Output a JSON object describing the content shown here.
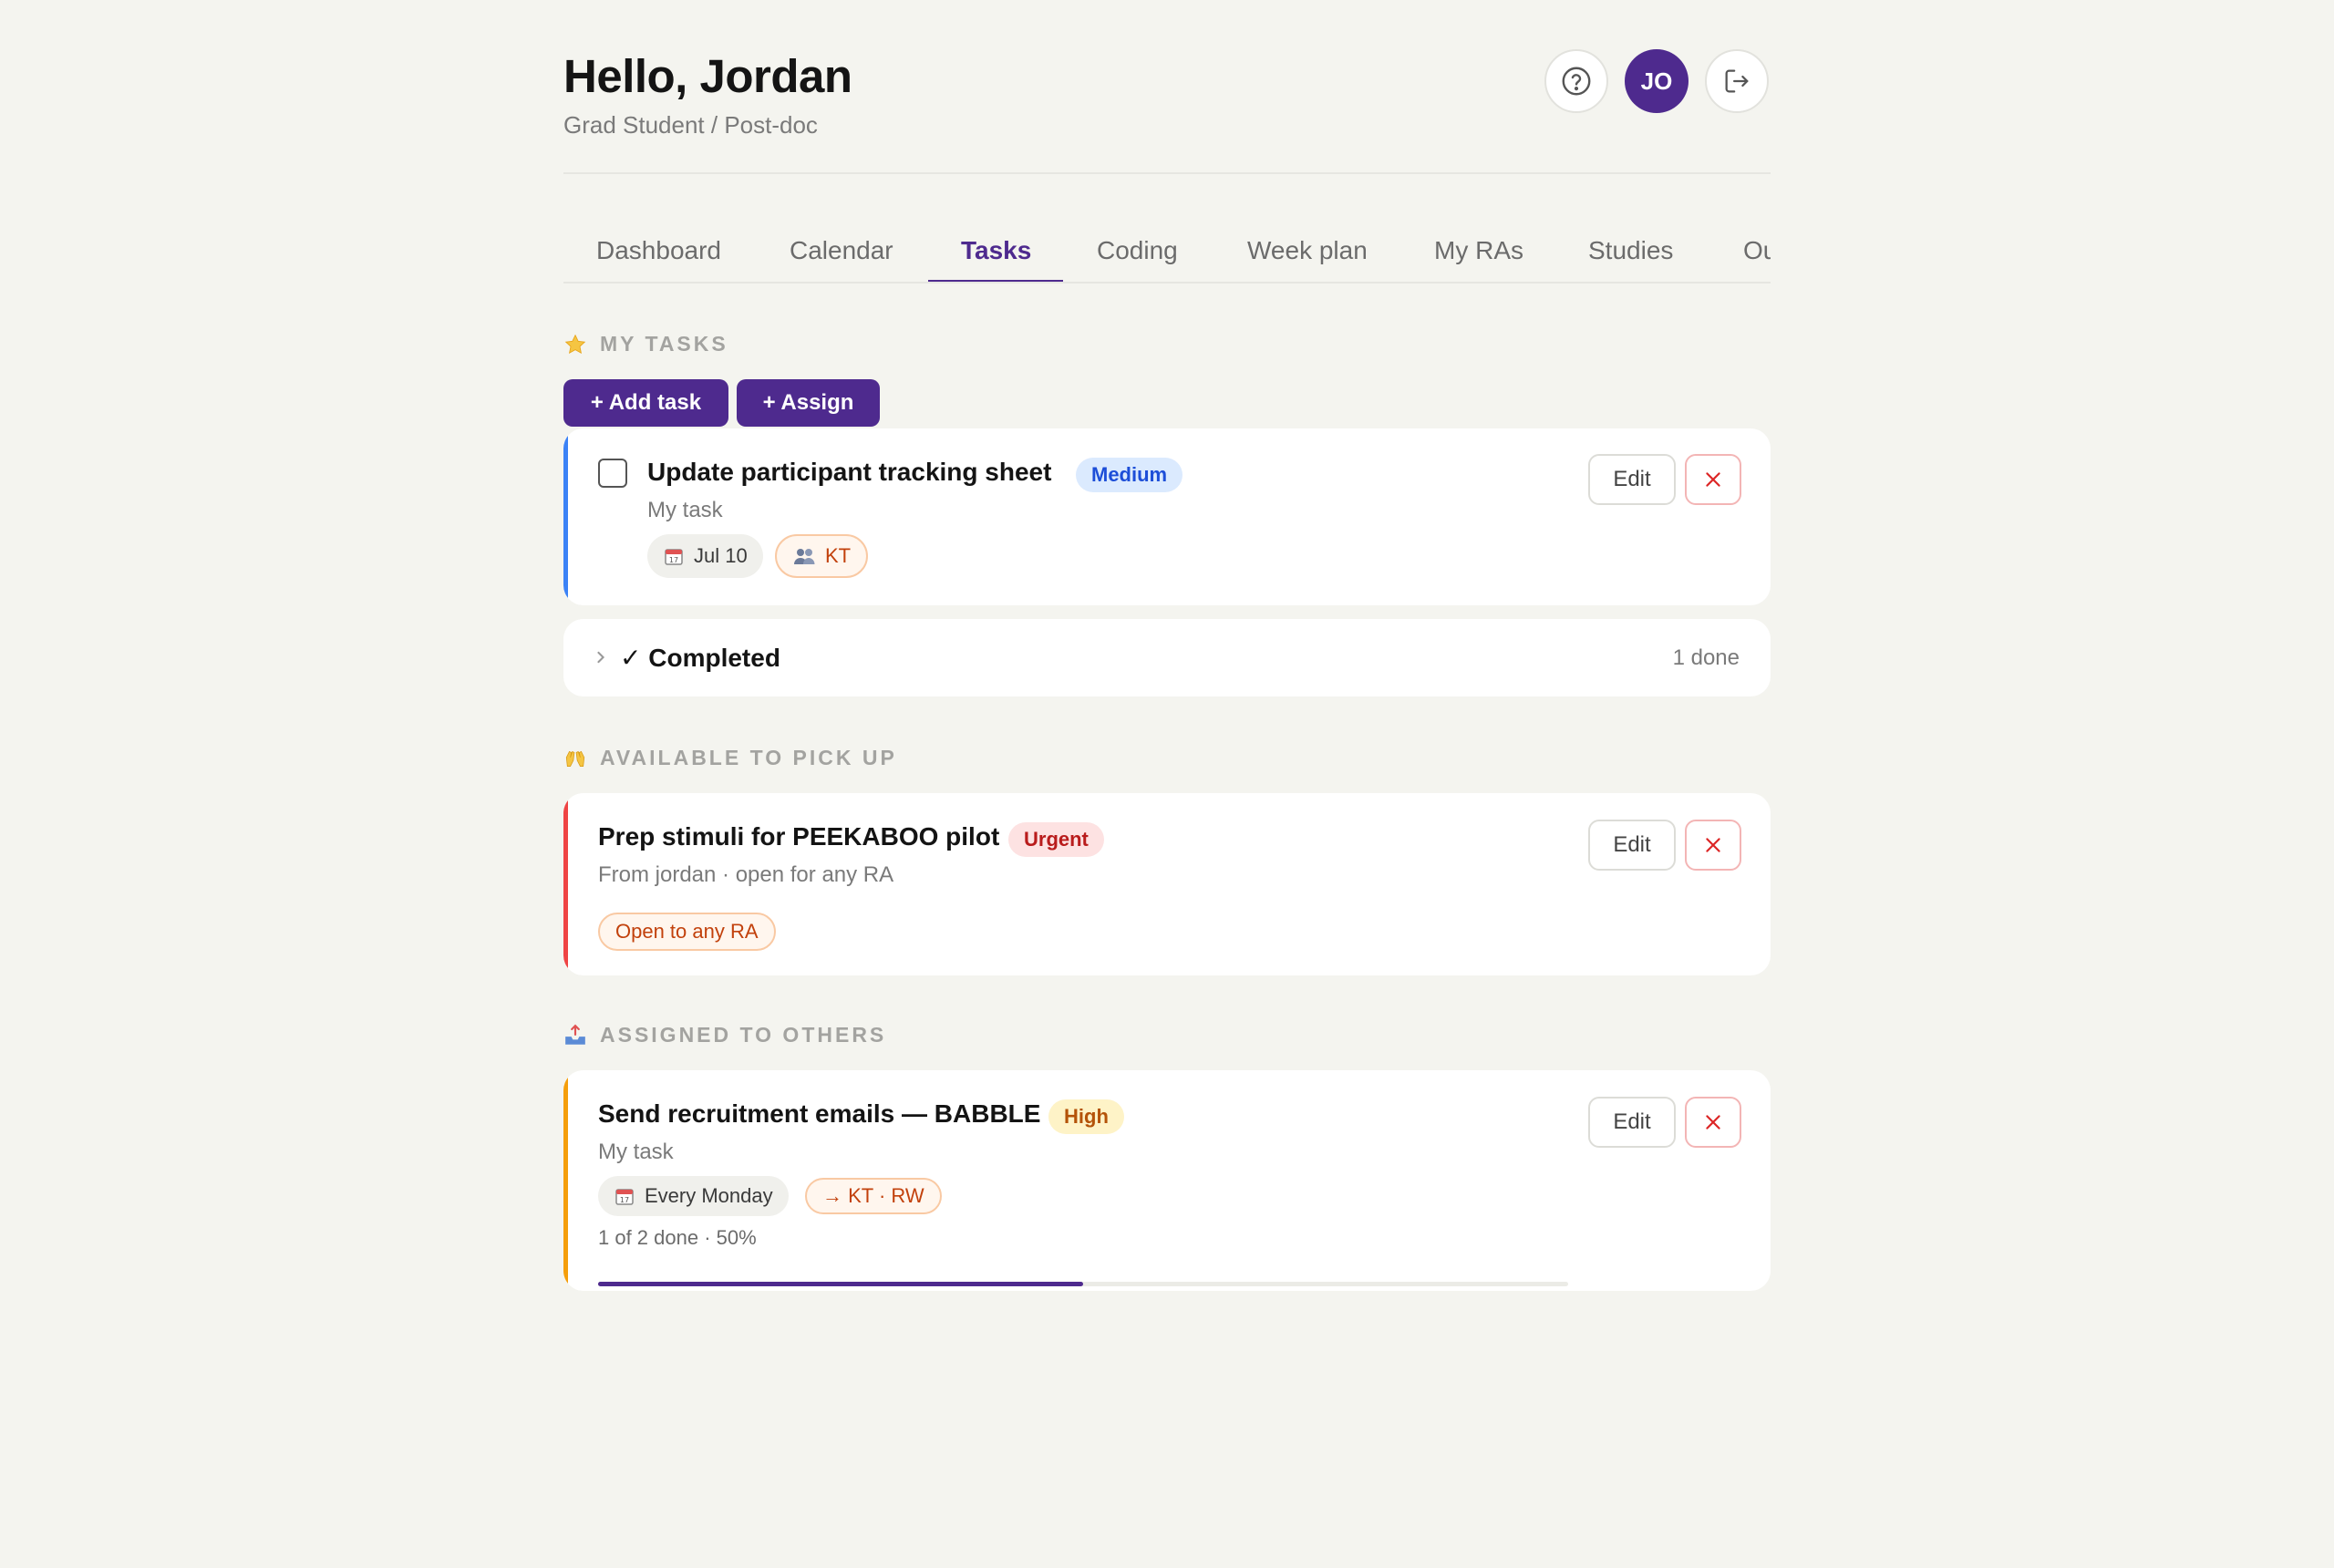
{
  "header": {
    "greeting": "Hello, Jordan",
    "role": "Grad Student / Post-doc",
    "avatar_initials": "JO",
    "help_icon": "question-circle-icon",
    "logout_icon": "logout-icon"
  },
  "tabs": [
    {
      "label": "Dashboard",
      "active": false
    },
    {
      "label": "Calendar",
      "active": false
    },
    {
      "label": "Tasks",
      "active": true
    },
    {
      "label": "Coding",
      "active": false
    },
    {
      "label": "Week plan",
      "active": false
    },
    {
      "label": "My RAs",
      "active": false
    },
    {
      "label": "Studies",
      "active": false
    },
    {
      "label": "Ou",
      "active": false
    }
  ],
  "my_tasks": {
    "heading": "MY TASKS",
    "icon": "star-icon",
    "add_task_label": "+ Add task",
    "assign_label": "+ Assign",
    "task": {
      "title": "Update participant tracking sheet",
      "priority": "Medium",
      "subtitle": "My task",
      "due": "Jul 10",
      "assignee": "KT",
      "edit_label": "Edit",
      "done": false
    },
    "completed": {
      "label": "✓ Completed",
      "count_label": "1 done"
    }
  },
  "available": {
    "heading": "AVAILABLE TO PICK UP",
    "icon": "raised-hands-icon",
    "task": {
      "title": "Prep stimuli for PEEKABOO pilot",
      "priority": "Urgent",
      "subtitle": "From jordan · open for any RA",
      "tag": "Open to any RA",
      "edit_label": "Edit"
    }
  },
  "assigned": {
    "heading": "ASSIGNED TO OTHERS",
    "icon": "outbox-tray-icon",
    "task": {
      "title": "Send recruitment emails — BABBLE",
      "priority": "High",
      "subtitle": "My task",
      "schedule": "Every Monday",
      "assignees": "→ KT · RW",
      "progress_label": "1 of 2 done · 50%",
      "progress": 0.5,
      "edit_label": "Edit"
    }
  },
  "colors": {
    "accent": "#4e2a8e",
    "medium_bar": "#3b82f6",
    "urgent_bar": "#ef4444",
    "high_bar": "#f59e0b"
  }
}
